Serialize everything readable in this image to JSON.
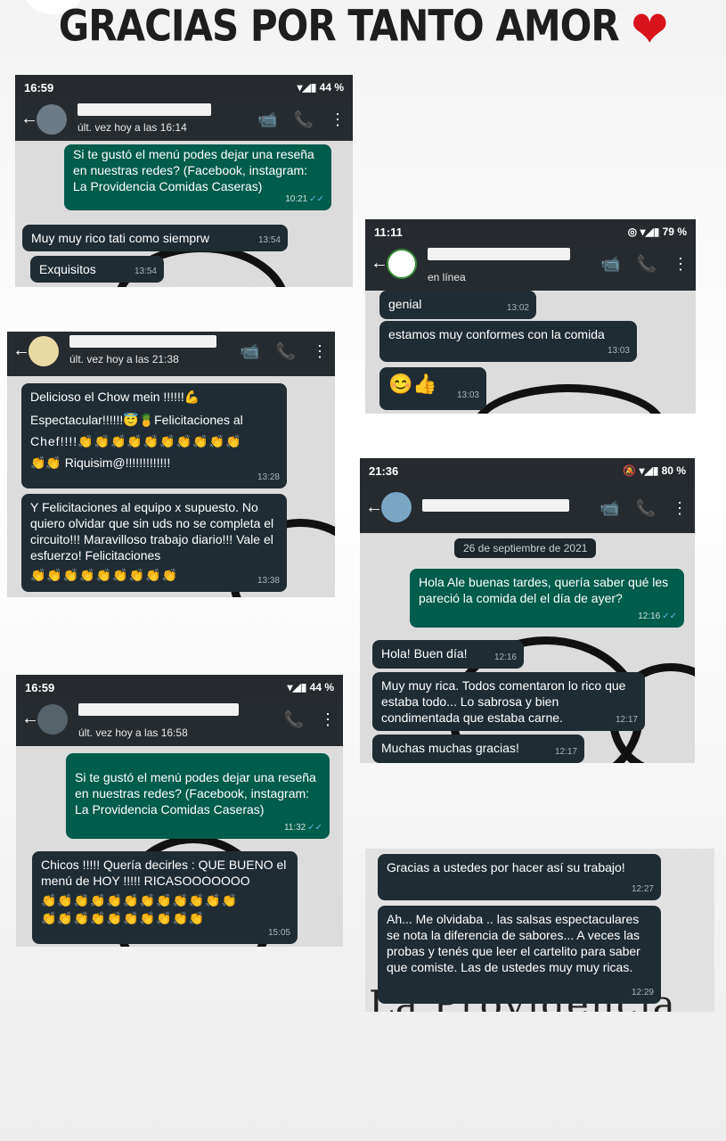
{
  "title": "GRACIAS POR TANTO AMOR",
  "heart": "❤",
  "shots": {
    "s1": {
      "status_time": "16:59",
      "status_right": "▾◢▮ 44 %",
      "last_seen": "últ. vez hoy a las 16:14",
      "bubble_out": "Si te gustó el menú podes dejar una reseña en nuestras redes? (Facebook, instagram: La Providencia Comidas Caseras)",
      "bubble_out_time": "10:21",
      "in1": "Muy muy rico tati como siemprw",
      "in1_time": "13:54",
      "in2": "Exquisitos",
      "in2_time": "13:54"
    },
    "s2": {
      "status_time": "11:11",
      "status_right": "◎ ▾◢▮ 79 %",
      "last_seen": "en línea",
      "in1": "genial",
      "in1_time": "13:02",
      "in2": "estamos muy conformes con la comida",
      "in2_time": "13:03",
      "in3": "😊👍",
      "in3_time": "13:03"
    },
    "s3": {
      "last_seen": "últ. vez hoy a las 21:38",
      "in1_line1": "Delicioso el Chow mein !!!!!!💪",
      "in1_line2": "Espectacular!!!!!!😇🍍Felicitaciones al",
      "in1_line3": "Chef!!!!👏👏👏👏👏👏👏👏👏👏",
      "in1_line4": "👏👏 Riquisim@!!!!!!!!!!!!!",
      "in1_time": "13:28",
      "in2_text": "Y Felicitaciones al equipo x supuesto. No quiero olvidar que sin uds no se completa el circuito!!! Maravilloso trabajo diario!!! Vale el esfuerzo! Felicitaciones",
      "in2_emojis": "👏👏👏👏👏👏👏👏👏",
      "in2_time": "13:38"
    },
    "s4": {
      "status_time": "21:36",
      "status_right": "🔕 ▾◢▮ 80 %",
      "date_chip": "26 de septiembre de 2021",
      "out1": "Hola Ale buenas tardes, quería saber qué les pareció la comida del el día de ayer?",
      "out1_time": "12:16",
      "in1": "Hola! Buen día!",
      "in1_time": "12:16",
      "in2": "Muy muy rica. Todos comentaron lo rico que estaba todo... Lo sabrosa y bien condimentada que estaba carne.",
      "in2_time": "12:17",
      "in3": "Muchas muchas gracias!",
      "in3_time": "12:17"
    },
    "s5": {
      "status_time": "16:59",
      "status_right": "▾◢▮ 44 %",
      "last_seen": "últ. vez hoy a las 16:58",
      "bubble_out": "Si te gustó el menú podes dejar una reseña en nuestras redes? (Facebook, instagram: La Providencia Comidas Caseras)",
      "bubble_out_time": "11:32",
      "in1_text": "Chicos !!!!! Quería decirles : QUE BUENO el menú de HOY !!!!! RICASOOOOOOO",
      "in1_emojis1": "👏👏👏👏👏👏👏👏👏👏👏👏",
      "in1_emojis2": "👏👏👏👏👏👏👏👏👏👏",
      "in1_time": "15:05"
    },
    "s6": {
      "in1": "Gracias a ustedes por hacer así su trabajo!",
      "in1_time": "12:27",
      "in2": "Ah... Me olvidaba .. las salsas espectaculares se nota la diferencia de sabores... A veces las probas y tenés que leer el cartelito para saber que comiste. Las de ustedes muy muy ricas.",
      "in2_time": "12:29",
      "bg_text": "La Providencia"
    }
  },
  "icons": {
    "back": "←",
    "video": "📹",
    "call": "📞",
    "more": "⋮"
  },
  "ticks": "✓✓"
}
